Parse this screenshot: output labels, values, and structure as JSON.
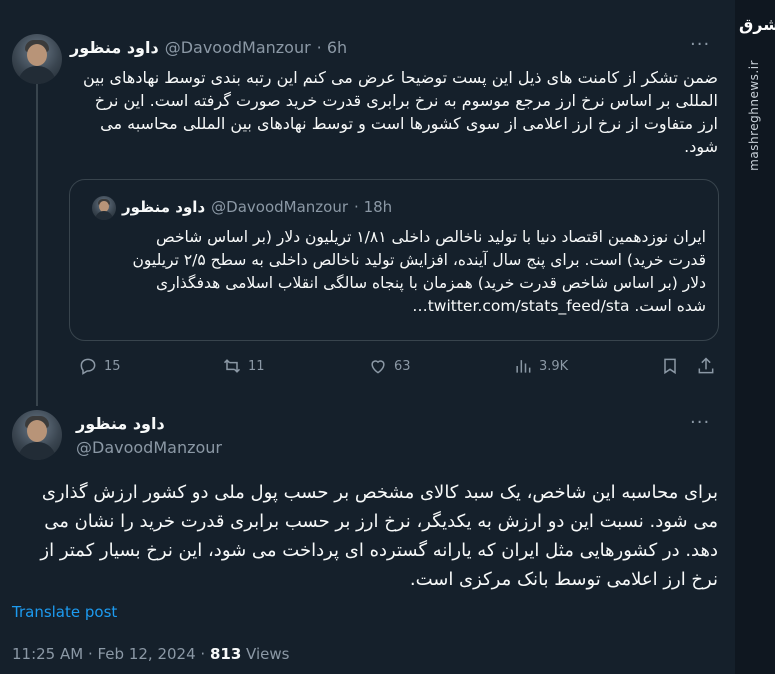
{
  "tweet1": {
    "name": "داود منظور",
    "handle": "@DavoodManzour",
    "time": "· 6h",
    "text": "ضمن تشکر از کامنت های ذیل این پست توضیحا عرض می کنم این رتبه بندی توسط نهادهای بین المللی بر اساس نرخ ارز مرجع موسوم به نرخ برابری قدرت خرید  صورت گرفته است. این نرخ ارز متفاوت از نرخ ارز اعلامی از سوی کشورها است و توسط نهادهای بین المللی محاسبه می شود."
  },
  "quote": {
    "name": "داود منظور",
    "handle": "@DavoodManzour",
    "time": "· 18h",
    "text": "ایران نوزدهمین اقتصاد دنیا با تولید ناخالص داخلی ۱/۸۱ تریلیون دلار (بر اساس شاخص قدرت خرید) است. برای پنج سال آینده، افزایش تولید ناخالص داخلی به سطح ۲/۵ تریلیون دلار (بر اساس شاخص قدرت خرید) همزمان با پنجاه سالگی انقلاب اسلامی هدفگذاری شده است. twitter.com/stats_feed/sta…"
  },
  "actions": {
    "replies": "15",
    "retweets": "11",
    "likes": "63",
    "views": "3.9K"
  },
  "tweet2": {
    "name": "داود منظور",
    "handle": "@DavoodManzour",
    "text": "برای محاسبه این شاخص، یک سبد کالای مشخص بر حسب پول ملی دو کشور ارزش گذاری می شود. نسبت این دو ارزش به یکدیگر، نرخ ارز بر حسب برابری قدرت خرید را نشان می دهد. در کشورهایی مثل ایران که یارانه گسترده ای پرداخت می شود، این نرخ بسیار کمتر از نرخ ارز اعلامی توسط بانک مرکزی است.",
    "translate": "Translate post",
    "timestamp": "11:25 AM · Feb 12, 2024 ·",
    "views_count": "813",
    "views_label": "Views"
  },
  "watermark": {
    "site": "mashreghnews.ir",
    "logo": "مشرق"
  },
  "colors": {
    "background": "#15202b",
    "accent": "#1d9bf0",
    "muted": "#8b98a5",
    "border": "#38444d"
  }
}
